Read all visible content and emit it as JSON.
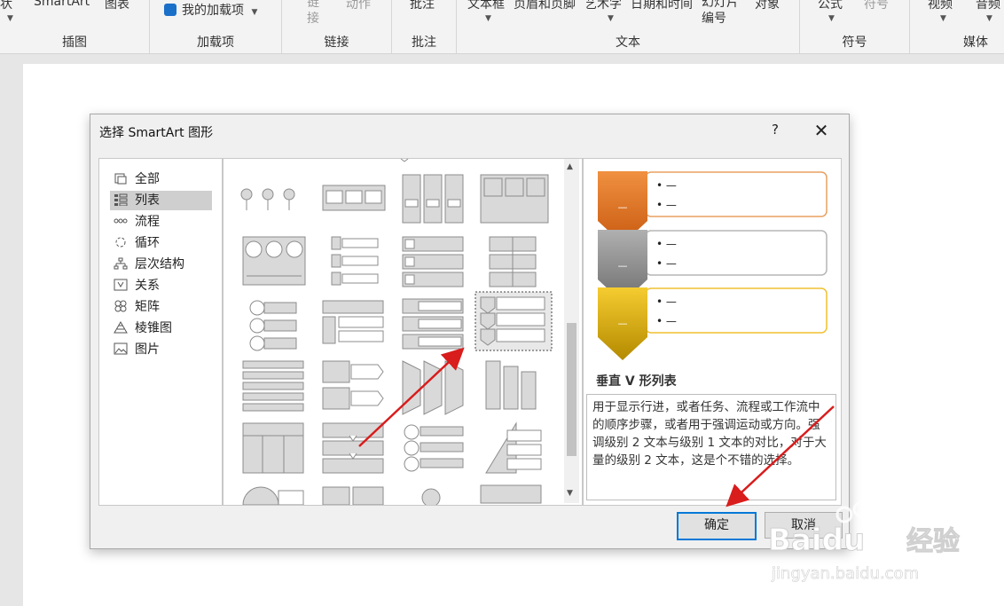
{
  "ribbon": {
    "groups": {
      "illustrations": {
        "items": [
          "形状",
          "SmartArt",
          "图表"
        ],
        "label": "插图"
      },
      "addins": {
        "my_addins": "我的加载项",
        "label": "加载项"
      },
      "links": {
        "items": [
          "链接",
          "动作"
        ],
        "label": "链接"
      },
      "comments": {
        "item": "批注",
        "label": "批注"
      },
      "text": {
        "items": [
          "文本框",
          "页眉和页脚",
          "艺术字",
          "日期和时间",
          "幻灯片编号",
          "对象"
        ],
        "label": "文本"
      },
      "symbols": {
        "items": [
          "公式",
          "符号"
        ],
        "label": "符号"
      },
      "media": {
        "items": [
          "视频",
          "音频"
        ],
        "label": "媒体"
      }
    }
  },
  "dialog": {
    "title": "选择 SmartArt 图形",
    "help": "?",
    "close": "✕",
    "categories": [
      {
        "label": "全部",
        "icon": "all-icon"
      },
      {
        "label": "列表",
        "icon": "list-icon",
        "selected": true
      },
      {
        "label": "流程",
        "icon": "process-icon"
      },
      {
        "label": "循环",
        "icon": "cycle-icon"
      },
      {
        "label": "层次结构",
        "icon": "hierarchy-icon"
      },
      {
        "label": "关系",
        "icon": "relationship-icon"
      },
      {
        "label": "矩阵",
        "icon": "matrix-icon"
      },
      {
        "label": "棱锥图",
        "icon": "pyramid-icon"
      },
      {
        "label": "图片",
        "icon": "picture-icon"
      }
    ],
    "preview": {
      "title": "垂直 V 形列表",
      "description": "用于显示行进，或者任务、流程或工作流中的顺序步骤，或者用于强调运动或方向。强调级别 2 文本与级别 1 文本的对比，对于大量的级别 2 文本，这是个不错的选择。",
      "colors": [
        "#e87722",
        "#8c8c8c",
        "#e8b400"
      ]
    },
    "ok": "确定",
    "cancel": "取消"
  },
  "watermark": {
    "brand": "Baidu",
    "brand_cn": "经验",
    "url": "jingyan.baidu.com"
  }
}
